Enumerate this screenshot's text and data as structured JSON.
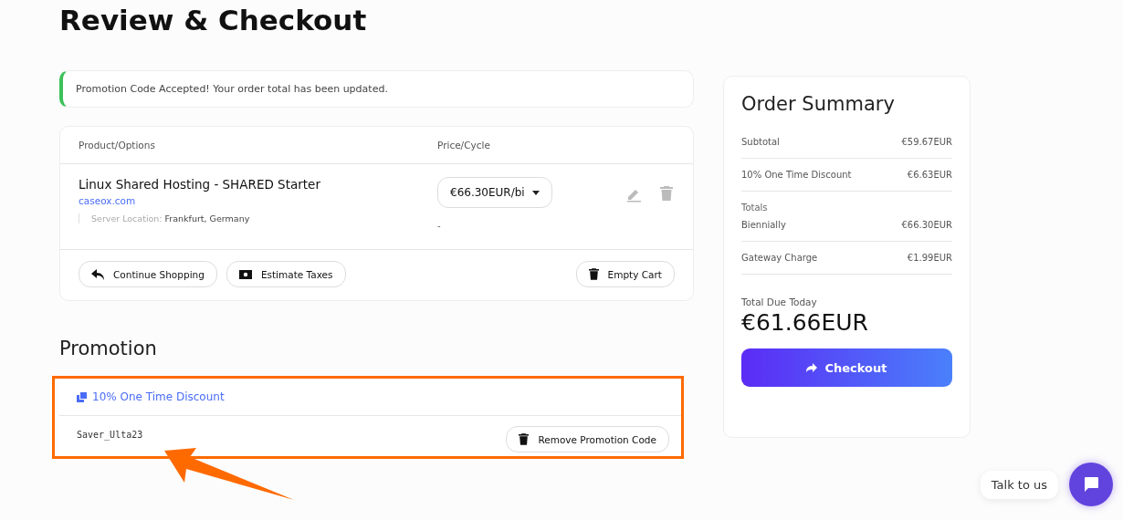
{
  "title": "Review & Checkout",
  "alert": {
    "text": "Promotion Code Accepted! Your order total has been updated."
  },
  "cart": {
    "columns": [
      "Product/Options",
      "Price/Cycle"
    ],
    "items": [
      {
        "name": "Linux Shared Hosting - SHARED Starter",
        "domain": "caseox.com",
        "option_label": "Server Location:",
        "option_value": "Frankfurt, Germany",
        "price": "€66.30EUR/bi",
        "price_note": "-"
      }
    ],
    "actions": [
      {
        "label": "Continue Shopping",
        "kind": "back"
      },
      {
        "label": "Estimate Taxes",
        "kind": "taxes"
      }
    ],
    "empty_button": "Empty Cart"
  },
  "promotion": {
    "heading": "Promotion",
    "name": "10% One Time Discount",
    "code": "Saver_Ulta23",
    "remove_button": "Remove Promotion Code",
    "highlighted": true
  },
  "summary": {
    "title": "Order Summary",
    "rows": [
      {
        "label": "Subtotal",
        "value": "€59.67EUR"
      },
      {
        "label": "10% One Time Discount",
        "value": "€6.63EUR"
      },
      {
        "heading": "Totals",
        "label": "Biennially",
        "value": "€66.30EUR"
      },
      {
        "label": "Gateway Charge",
        "value": "€1.99EUR"
      }
    ],
    "total_label": "Total Due Today",
    "total": "€61.66EUR",
    "checkout_button": "Checkout"
  },
  "chat": {
    "label": "Talk to us"
  }
}
